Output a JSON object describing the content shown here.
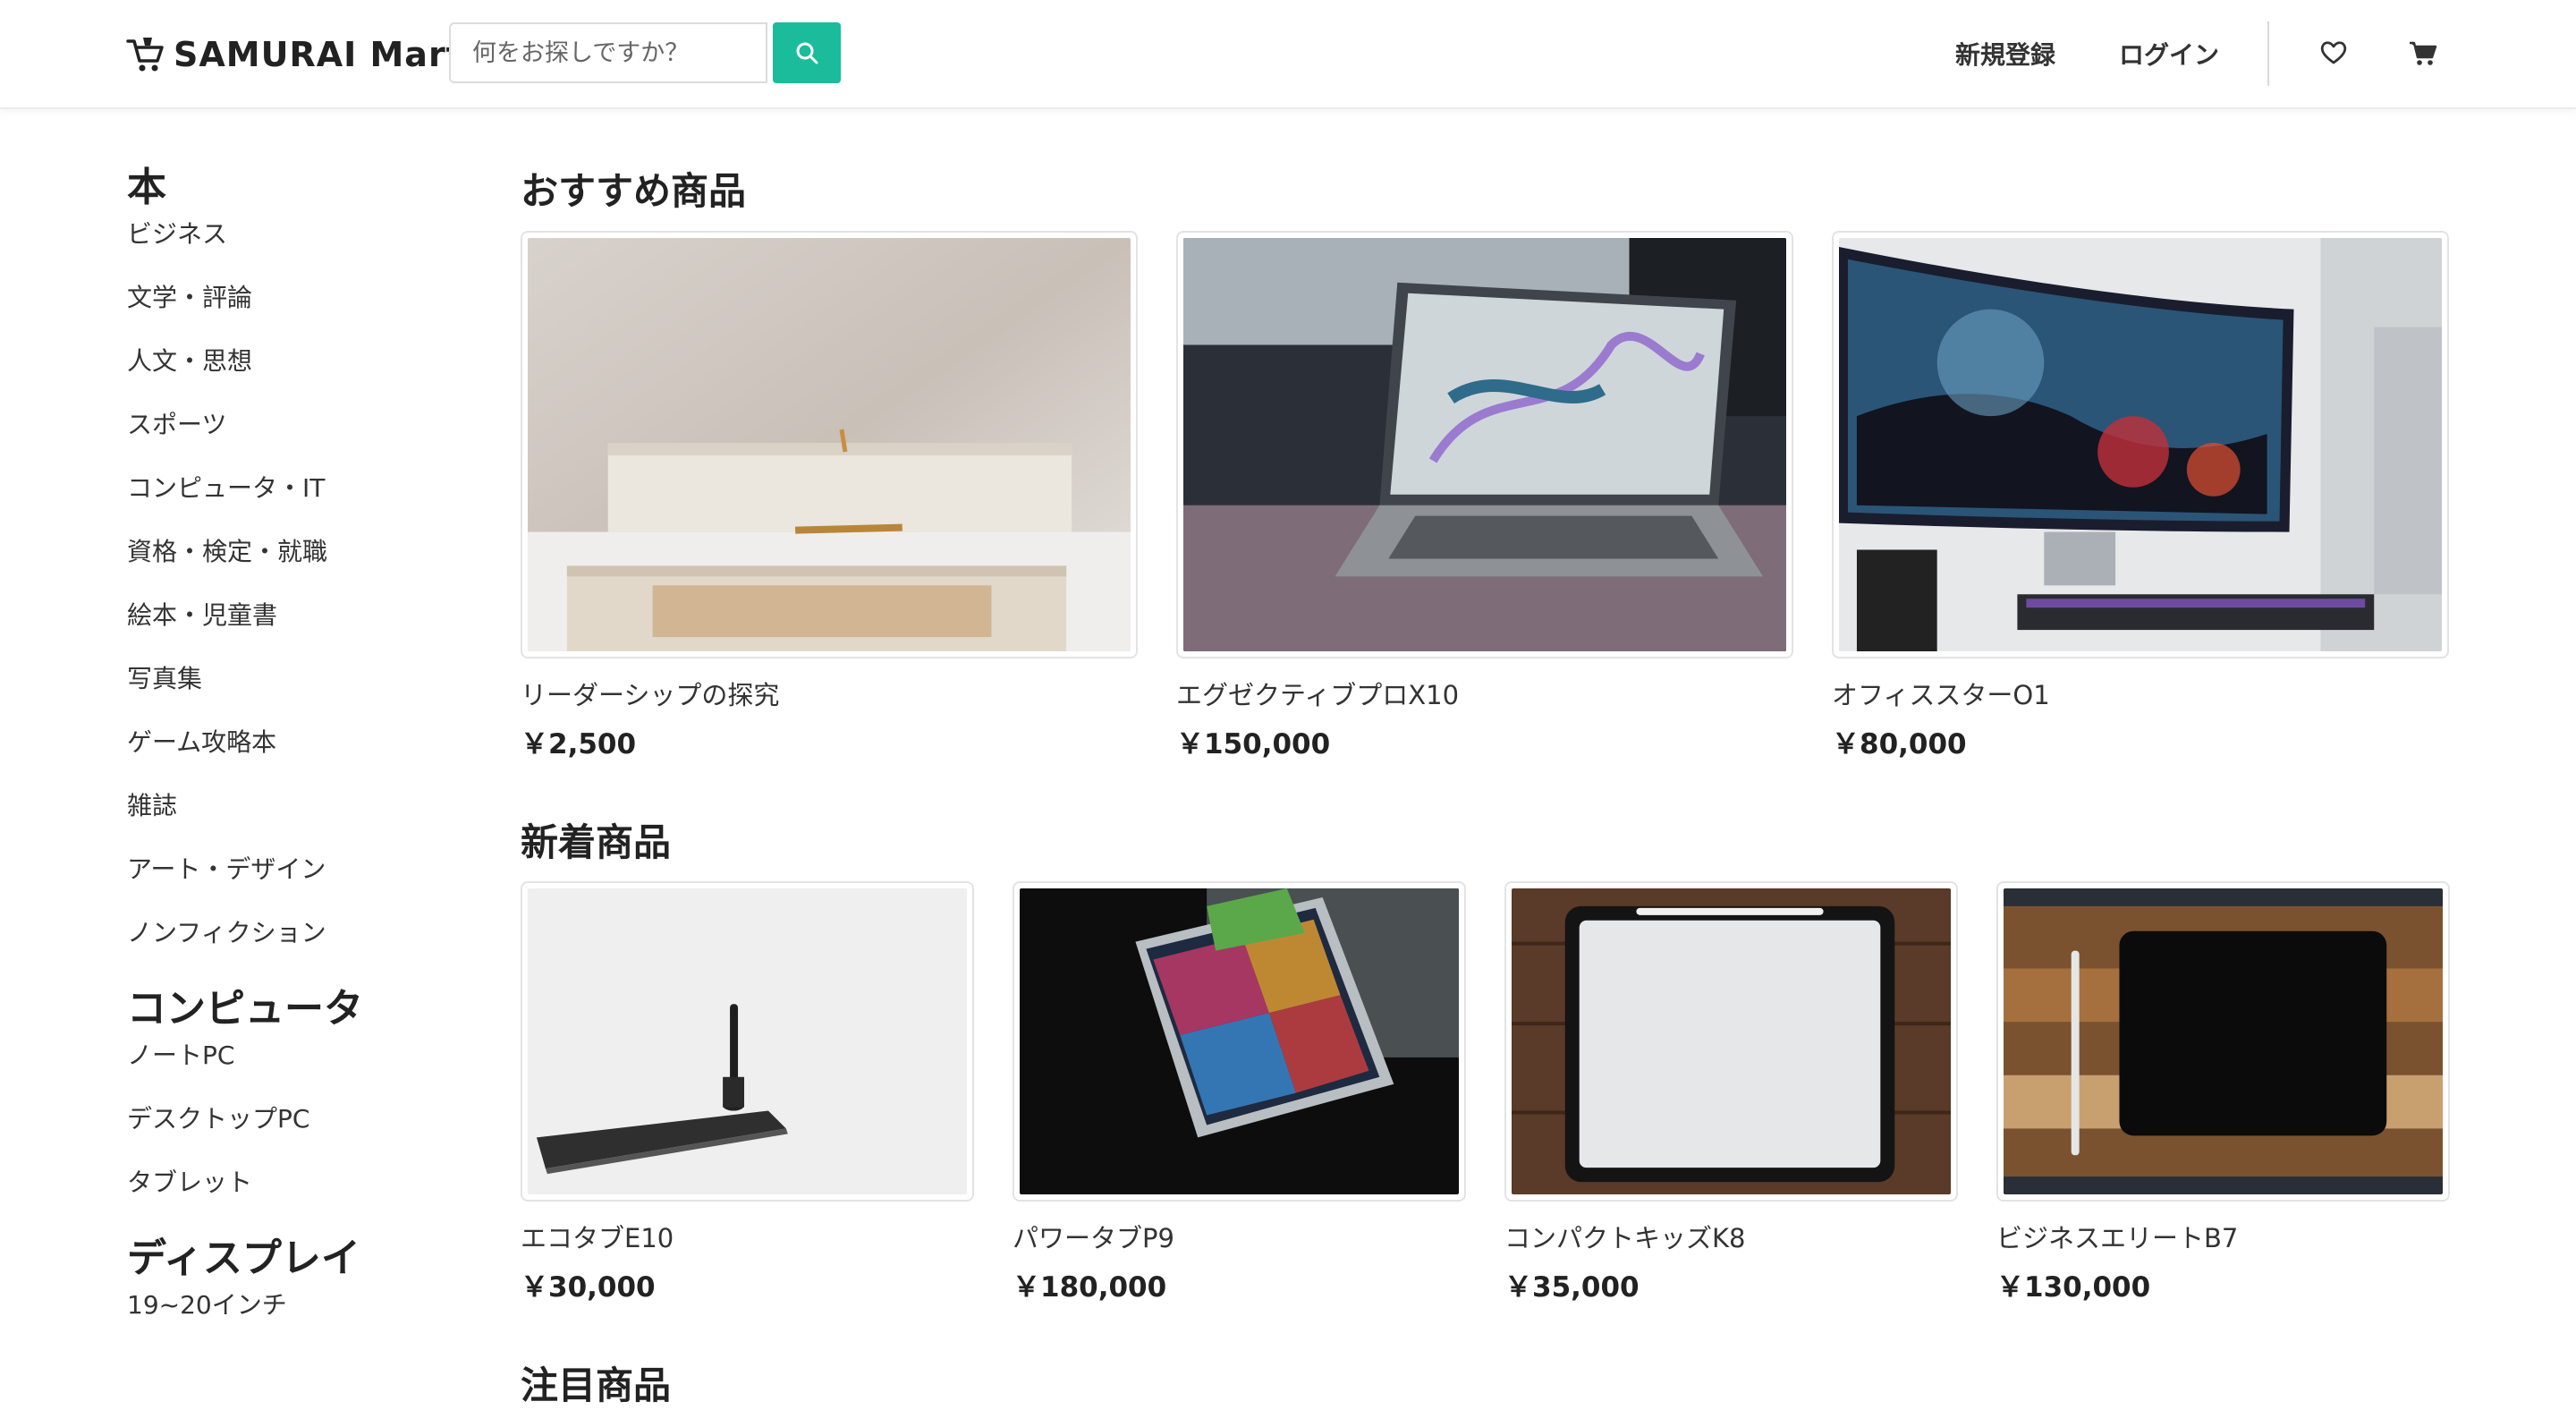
{
  "header": {
    "brand": "SAMURAI Mart",
    "search_placeholder": "何をお探しですか？",
    "signup_label": "新規登録",
    "login_label": "ログイン",
    "icons": [
      "cart-logo-icon",
      "search-icon",
      "heart-icon",
      "cart-icon"
    ],
    "accent_color": "#1abc9c"
  },
  "sidebar": {
    "groups": [
      {
        "title": "本",
        "items": [
          "ビジネス",
          "文学・評論",
          "人文・思想",
          "スポーツ",
          "コンピュータ・IT",
          "資格・検定・就職",
          "絵本・児童書",
          "写真集",
          "ゲーム攻略本",
          "雑誌",
          "アート・デザイン",
          "ノンフィクション"
        ]
      },
      {
        "title": "コンピュータ",
        "items": [
          "ノートPC",
          "デスクトップPC",
          "タブレット"
        ]
      },
      {
        "title": "ディスプレイ",
        "items": [
          "19~20インチ"
        ]
      }
    ]
  },
  "recommended": {
    "title": "おすすめ商品",
    "products": [
      {
        "name": "リーダーシップの探究",
        "price": "￥2,500",
        "image": "stacked-books-photo"
      },
      {
        "name": "エグゼクティブプロX10",
        "price": "￥150,000",
        "image": "laptop-photo"
      },
      {
        "name": "オフィススターO1",
        "price": "￥80,000",
        "image": "curved-monitor-photo"
      }
    ]
  },
  "new_arrivals": {
    "title": "新着商品",
    "products": [
      {
        "name": "エコタブE10",
        "price": "￥30,000",
        "image": "pen-tablet-photo"
      },
      {
        "name": "パワータブP9",
        "price": "￥180,000",
        "image": "ipad-photo"
      },
      {
        "name": "コンパクトキッズK8",
        "price": "￥35,000",
        "image": "white-tablet-photo"
      },
      {
        "name": "ビジネスエリートB7",
        "price": "￥130,000",
        "image": "black-tablet-photo"
      }
    ]
  },
  "featured": {
    "title": "注目商品"
  }
}
